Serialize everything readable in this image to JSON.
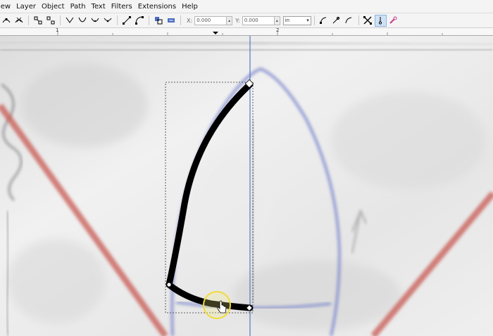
{
  "menu": [
    "iew",
    "Layer",
    "Object",
    "Path",
    "Text",
    "Filters",
    "Extensions",
    "Help"
  ],
  "toolbar": {
    "x_label": "X:",
    "x_value": "0.000",
    "y_label": "Y:",
    "y_value": "0.000",
    "unit": "in",
    "icons_left": [
      "node-corner-icon",
      "node-smooth-icon",
      "node-join-icon",
      "node-break-icon",
      "node-add-icon",
      "node-delete-icon",
      "segment-curve-icon",
      "segment-line-icon",
      "segment-bezier-icon",
      "node-symmetric-icon",
      "node-auto-icon",
      "object-to-path-icon",
      "stroke-to-path-icon"
    ],
    "icons_right": [
      "show-handles-icon",
      "show-outline-icon",
      "transform-handles-icon",
      "clip-path-icon",
      "mask-icon"
    ]
  },
  "ruler": {
    "labels": [
      "1",
      "2"
    ]
  },
  "colors": {
    "guide": "#4a6cc4",
    "stroke": "#000000",
    "cursor_ring": "#f0dc3a",
    "sketch_red": "#c85a52",
    "sketch_blue": "#7c86cc"
  }
}
